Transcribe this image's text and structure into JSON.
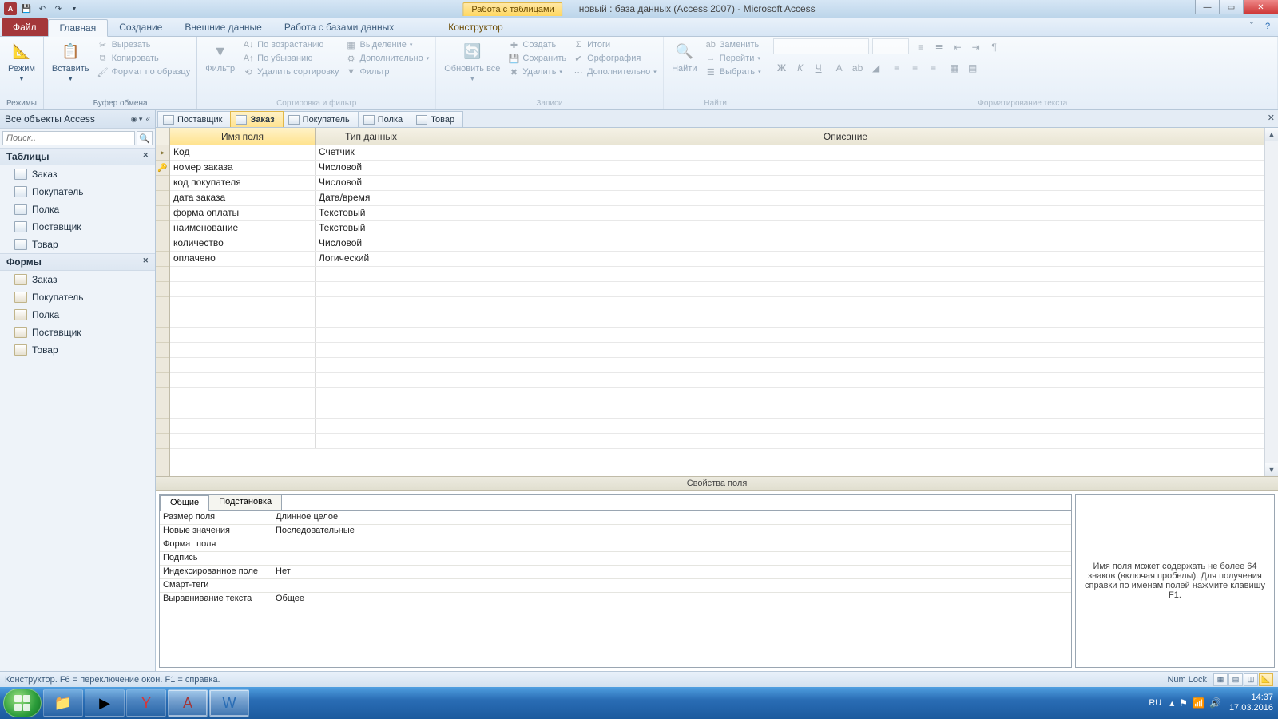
{
  "title": {
    "tool_context": "Работа с таблицами",
    "document": "новый : база данных (Access 2007) - Microsoft Access"
  },
  "ribbon": {
    "file": "Файл",
    "tabs": [
      "Главная",
      "Создание",
      "Внешние данные",
      "Работа с базами данных"
    ],
    "context_tab": "Конструктор",
    "active_index": 0,
    "groups": {
      "views": {
        "label": "Режимы",
        "mode": "Режим"
      },
      "clipboard": {
        "label": "Буфер обмена",
        "paste": "Вставить",
        "cut": "Вырезать",
        "copy": "Копировать",
        "format_painter": "Формат по образцу"
      },
      "sortfilter": {
        "label": "Сортировка и фильтр",
        "filter": "Фильтр",
        "asc": "По возрастанию",
        "desc": "По убыванию",
        "clear": "Удалить сортировку",
        "selection": "Выделение",
        "advanced": "Дополнительно",
        "toggle": "Фильтр"
      },
      "records": {
        "label": "Записи",
        "refresh": "Обновить все",
        "new": "Создать",
        "save": "Сохранить",
        "delete": "Удалить",
        "totals": "Итоги",
        "spelling": "Орфография",
        "more": "Дополнительно"
      },
      "find": {
        "label": "Найти",
        "find": "Найти",
        "replace": "Заменить",
        "goto": "Перейти",
        "select": "Выбрать"
      },
      "textfmt": {
        "label": "Форматирование текста"
      }
    }
  },
  "nav": {
    "header": "Все объекты Access",
    "search_placeholder": "Поиск..",
    "groups": [
      {
        "title": "Таблицы",
        "items": [
          "Заказ",
          "Покупатель",
          "Полка",
          "Поставщик",
          "Товар"
        ],
        "icon": "table"
      },
      {
        "title": "Формы",
        "items": [
          "Заказ",
          "Покупатель",
          "Полка",
          "Поставщик",
          "Товар"
        ],
        "icon": "form"
      }
    ]
  },
  "doctabs": {
    "tabs": [
      "Поставщик",
      "Заказ",
      "Покупатель",
      "Полка",
      "Товар"
    ],
    "active_index": 1
  },
  "design_grid": {
    "columns": [
      "Имя поля",
      "Тип данных",
      "Описание"
    ],
    "rows": [
      {
        "name": "Код",
        "type": "Счетчик",
        "selected": true,
        "key": false
      },
      {
        "name": "номер заказа",
        "type": "Числовой",
        "key": true
      },
      {
        "name": "код покупателя",
        "type": "Числовой"
      },
      {
        "name": "дата заказа",
        "type": "Дата/время"
      },
      {
        "name": "форма оплаты",
        "type": "Текстовый"
      },
      {
        "name": "наименование",
        "type": "Текстовый"
      },
      {
        "name": "количество",
        "type": "Числовой"
      },
      {
        "name": "оплачено",
        "type": "Логический"
      }
    ],
    "blank_rows": 12
  },
  "properties": {
    "header": "Свойства поля",
    "tabs": [
      "Общие",
      "Подстановка"
    ],
    "active_tab": 0,
    "rows": [
      {
        "k": "Размер поля",
        "v": "Длинное целое"
      },
      {
        "k": "Новые значения",
        "v": "Последовательные"
      },
      {
        "k": "Формат поля",
        "v": ""
      },
      {
        "k": "Подпись",
        "v": ""
      },
      {
        "k": "Индексированное поле",
        "v": "Нет"
      },
      {
        "k": "Смарт-теги",
        "v": ""
      },
      {
        "k": "Выравнивание текста",
        "v": "Общее"
      }
    ],
    "hint": "Имя поля может содержать не более 64 знаков (включая пробелы). Для получения справки по именам полей нажмите клавишу F1."
  },
  "status": {
    "left": "Конструктор.  F6 = переключение окон.  F1 = справка.",
    "numlock": "Num Lock"
  },
  "taskbar": {
    "lang": "RU",
    "time": "14:37",
    "date": "17.03.2016"
  }
}
